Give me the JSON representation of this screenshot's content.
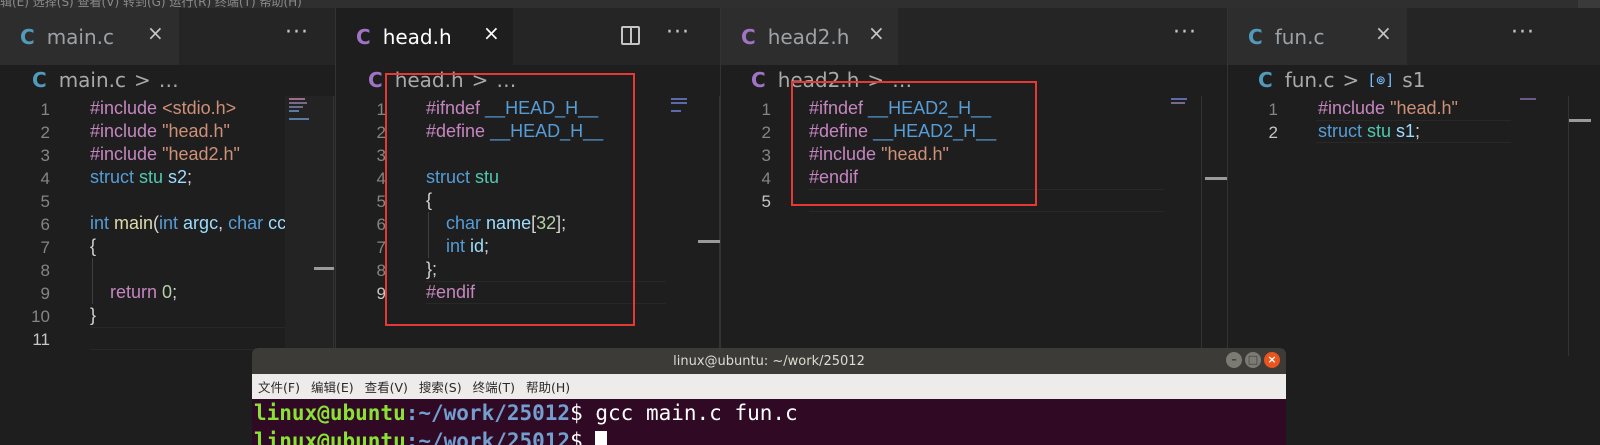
{
  "menu_strip": "辑(E)  选择(S)  查看(V)  转到(G)  运行(R)  终端(T)  帮助(H)",
  "panes": [
    {
      "tab": "main.c",
      "icon": "c-file-icon",
      "breadcrumb": [
        "main.c",
        ">",
        "…"
      ],
      "line_numbers": [
        "1",
        "2",
        "3",
        "4",
        "5",
        "6",
        "7",
        "8",
        "9",
        "10",
        "11"
      ],
      "current_line": "11",
      "code": [
        [
          [
            "pp",
            "#include "
          ],
          [
            "st",
            "<stdio.h>"
          ]
        ],
        [
          [
            "pp",
            "#include "
          ],
          [
            "st",
            "\"head.h\""
          ]
        ],
        [
          [
            "pp",
            "#include "
          ],
          [
            "st",
            "\"head2.h\""
          ]
        ],
        [
          [
            "kw",
            "struct "
          ],
          [
            "ty",
            "stu "
          ],
          [
            "va",
            "s2"
          ],
          [
            "pu",
            ";"
          ]
        ],
        [],
        [
          [
            "kw",
            "int "
          ],
          [
            "fn",
            "main"
          ],
          [
            "pu",
            "("
          ],
          [
            "kw",
            "int "
          ],
          [
            "va",
            "argc"
          ],
          [
            "pu",
            ", "
          ],
          [
            "kw",
            "char "
          ],
          [
            "va",
            "cc"
          ]
        ],
        [
          [
            "pu",
            "{"
          ]
        ],
        [],
        [
          [
            "pu",
            "    "
          ],
          [
            "pp",
            "return "
          ],
          [
            "nu",
            "0"
          ],
          [
            "pu",
            ";"
          ]
        ],
        [
          [
            "pu",
            "}"
          ]
        ],
        []
      ]
    },
    {
      "tab": "head.h",
      "icon": "c-file-icon",
      "breadcrumb": [
        "head.h",
        ">",
        "…"
      ],
      "line_numbers": [
        "1",
        "2",
        "3",
        "4",
        "5",
        "6",
        "7",
        "8",
        "9"
      ],
      "current_line": "9",
      "code": [
        [
          [
            "pp",
            "#ifndef "
          ],
          [
            "kw",
            "__HEAD_H__"
          ]
        ],
        [
          [
            "pp",
            "#define "
          ],
          [
            "kw",
            "__HEAD_H__"
          ]
        ],
        [],
        [
          [
            "kw",
            "struct "
          ],
          [
            "ty",
            "stu"
          ]
        ],
        [
          [
            "pu",
            "{"
          ]
        ],
        [
          [
            "pu",
            "    "
          ],
          [
            "kw",
            "char "
          ],
          [
            "va",
            "name"
          ],
          [
            "pu",
            "["
          ],
          [
            "nu",
            "32"
          ],
          [
            "pu",
            "];"
          ]
        ],
        [
          [
            "pu",
            "    "
          ],
          [
            "kw",
            "int "
          ],
          [
            "va",
            "id"
          ],
          [
            "pu",
            ";"
          ]
        ],
        [
          [
            "pu",
            "};"
          ]
        ],
        [
          [
            "pp",
            "#endif"
          ]
        ]
      ]
    },
    {
      "tab": "head2.h",
      "icon": "c-file-icon",
      "breadcrumb": [
        "head2.h",
        ">",
        "…"
      ],
      "line_numbers": [
        "1",
        "2",
        "3",
        "4",
        "5"
      ],
      "current_line": "5",
      "code": [
        [
          [
            "pp",
            "#ifndef "
          ],
          [
            "kw",
            "__HEAD2_H__"
          ]
        ],
        [
          [
            "pp",
            "#define "
          ],
          [
            "kw",
            "__HEAD2_H__"
          ]
        ],
        [
          [
            "pp",
            "#include "
          ],
          [
            "st",
            "\"head.h\""
          ]
        ],
        [
          [
            "pp",
            "#endif"
          ]
        ],
        []
      ]
    },
    {
      "tab": "fun.c",
      "icon": "c-file-icon",
      "breadcrumb": [
        "fun.c",
        ">",
        "s1"
      ],
      "line_numbers": [
        "1",
        "2"
      ],
      "current_line": "2",
      "code": [
        [
          [
            "pp",
            "#include "
          ],
          [
            "st",
            "\"head.h\""
          ]
        ],
        [
          [
            "kw",
            "struct "
          ],
          [
            "ty",
            "stu "
          ],
          [
            "va",
            "s1"
          ],
          [
            "pu",
            ";"
          ]
        ]
      ]
    }
  ],
  "close_glyph": "×",
  "more_glyph": "···",
  "terminal": {
    "title": "linux@ubuntu: ~/work/25012",
    "menu": [
      "文件(F)",
      "编辑(E)",
      "查看(V)",
      "搜索(S)",
      "终端(T)",
      "帮助(H)"
    ],
    "user": "linux@ubuntu",
    "path": ":~/work/25012",
    "prompt": "$ ",
    "command": "gcc main.c fun.c"
  }
}
